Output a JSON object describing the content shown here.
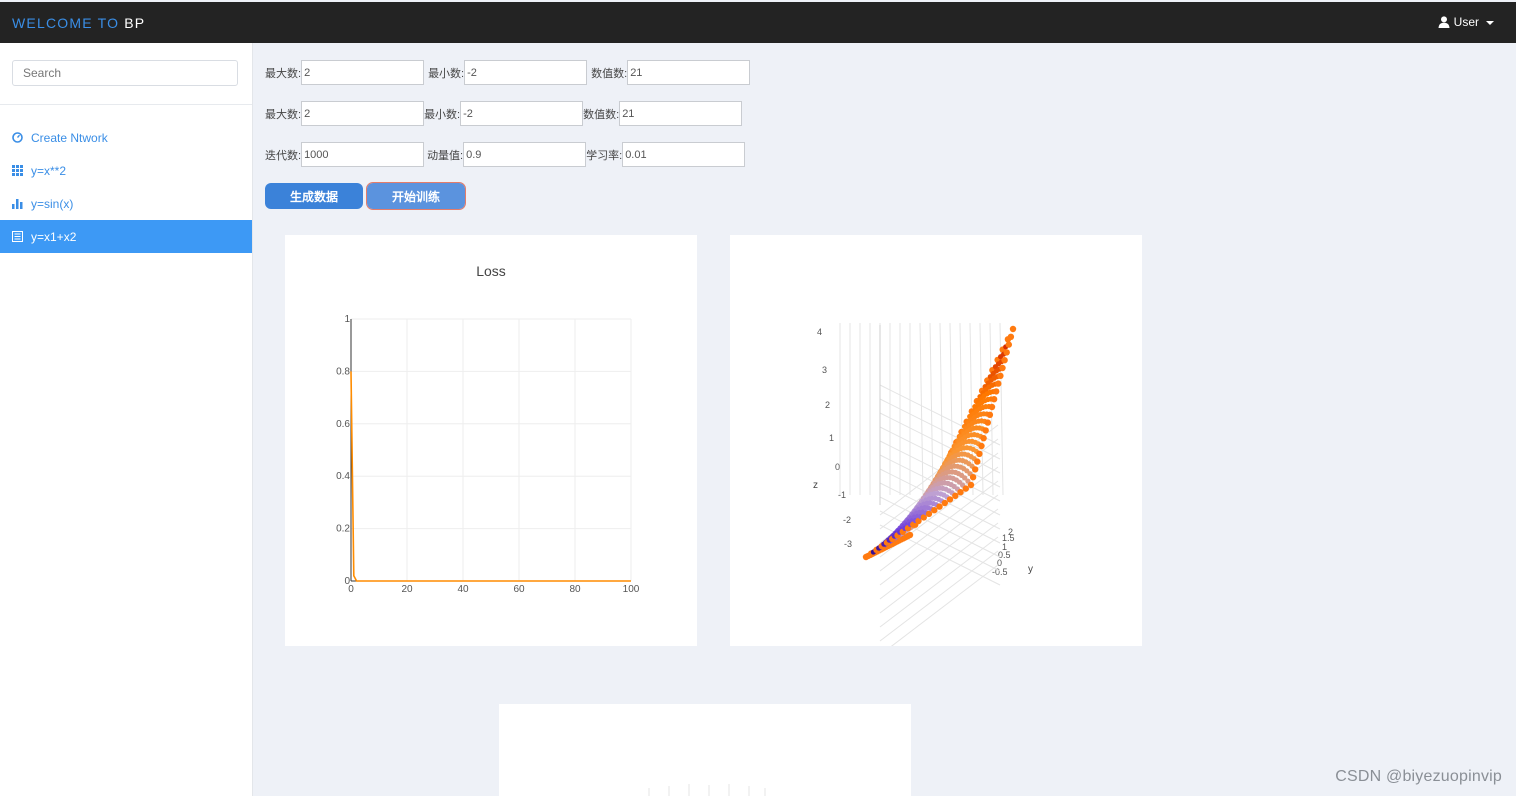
{
  "header": {
    "brand_prefix": "WELCOME TO",
    "brand_name": "BP",
    "user_label": "User"
  },
  "sidebar": {
    "search_placeholder": "Search",
    "items": [
      {
        "label": "Create Ntwork",
        "icon": "dashboard-icon",
        "active": false
      },
      {
        "label": "y=x**2",
        "icon": "grid-icon",
        "active": false
      },
      {
        "label": "y=sin(x)",
        "icon": "bar-chart-icon",
        "active": false
      },
      {
        "label": "y=x1+x2",
        "icon": "list-icon",
        "active": true
      }
    ]
  },
  "form": {
    "row1": {
      "max_label": "最大数:",
      "max_value": "2",
      "min_label": "最小数:",
      "min_value": "-2",
      "count_label": "数值数:",
      "count_value": "21"
    },
    "row2": {
      "max_label": "最大数:",
      "max_value": "2",
      "min_label": "最小数:",
      "min_value": "-2",
      "count_label": "数值数:",
      "count_value": "21"
    },
    "row3": {
      "iter_label": "迭代数:",
      "iter_value": "1000",
      "momentum_label": "动量值:",
      "momentum_value": "0.9",
      "lr_label": "学习率:",
      "lr_value": "0.01"
    },
    "generate_button": "生成数据",
    "train_button": "开始训练"
  },
  "colors": {
    "accent": "#3d99f5",
    "topbar": "#232323",
    "loss_line": "#ff8c00"
  },
  "chart_data": [
    {
      "type": "line",
      "title": "Loss",
      "x": [
        0,
        1,
        2,
        3,
        100
      ],
      "y": [
        0.8,
        0.02,
        0.0,
        0.0,
        0.0
      ],
      "xlim": [
        0,
        100
      ],
      "ylim": [
        0,
        1
      ],
      "x_ticks": [
        "0",
        "20",
        "40",
        "60",
        "80",
        "100"
      ],
      "y_ticks": [
        "0",
        "0.2",
        "0.4",
        "0.6",
        "0.8",
        "1"
      ],
      "grid": true
    },
    {
      "type": "scatter",
      "title": "",
      "z_axis_label": "z",
      "y_axis_label": "y",
      "z_ticks": [
        "4",
        "3",
        "2",
        "1",
        "0",
        "-1",
        "-2",
        "-3"
      ],
      "y_ticks": [
        "2",
        "1.5",
        "1",
        "0.5",
        "0",
        "-0.5"
      ],
      "x_range": [
        -2,
        2
      ],
      "y_range": [
        -2,
        2
      ],
      "z_range": [
        -4,
        4
      ],
      "points_per_axis": 21,
      "surface": "z = x + y"
    }
  ],
  "watermark": "CSDN @biyezuopinvip"
}
